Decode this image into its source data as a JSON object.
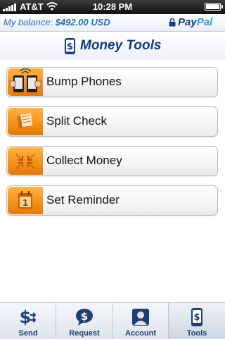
{
  "status_bar": {
    "carrier": "AT&T",
    "time": "10:28 PM"
  },
  "balance": {
    "label": "My balance:",
    "amount": "$492.00 USD"
  },
  "brand": {
    "pay": "Pay",
    "pal": "Pal"
  },
  "header": {
    "title": "Money Tools"
  },
  "tools": [
    {
      "label": "Bump Phones",
      "icon": "bump-phones-icon"
    },
    {
      "label": "Split Check",
      "icon": "split-check-icon"
    },
    {
      "label": "Collect Money",
      "icon": "collect-money-icon"
    },
    {
      "label": "Set Reminder",
      "icon": "calendar-reminder-icon"
    }
  ],
  "tab_bar": [
    {
      "label": "Send",
      "icon": "send-money-icon"
    },
    {
      "label": "Request",
      "icon": "request-money-icon"
    },
    {
      "label": "Account",
      "icon": "account-person-icon"
    },
    {
      "label": "Tools",
      "icon": "tools-phone-icon",
      "active": true
    }
  ],
  "colors": {
    "accent_orange": "#f7941d",
    "balance_blue": "#1f6fb8",
    "title_navy": "#143a79",
    "paypal_dark": "#163f86",
    "paypal_light": "#2a9bd8"
  }
}
